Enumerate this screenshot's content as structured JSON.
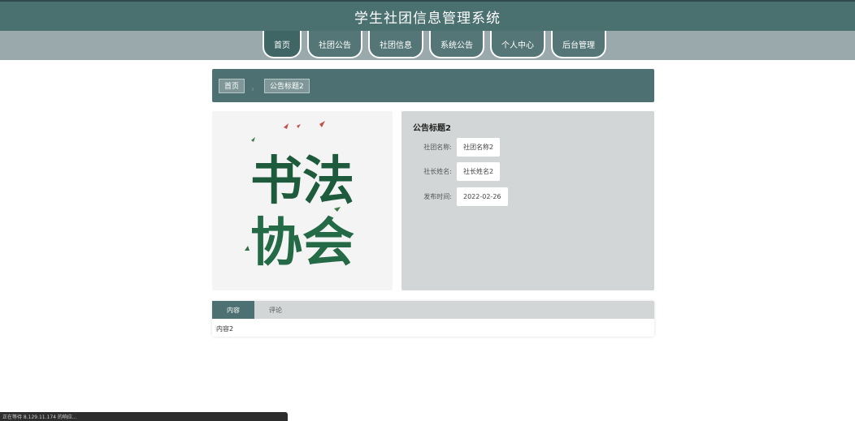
{
  "header": {
    "title": "学生社团信息管理系统"
  },
  "nav": {
    "items": [
      {
        "label": "首页"
      },
      {
        "label": "社团公告"
      },
      {
        "label": "社团信息"
      },
      {
        "label": "系统公告"
      },
      {
        "label": "个人中心"
      },
      {
        "label": "后台管理"
      }
    ]
  },
  "breadcrumb": {
    "home": "首页",
    "current": "公告标题2"
  },
  "image": {
    "text_line1": "书法",
    "text_line2": "协会"
  },
  "detail": {
    "title": "公告标题2",
    "fields": [
      {
        "label": "社团名称:",
        "value": "社团名称2"
      },
      {
        "label": "社长姓名:",
        "value": "社长姓名2"
      },
      {
        "label": "发布时间:",
        "value": "2022-02-26"
      }
    ]
  },
  "tabs": [
    {
      "label": "内容"
    },
    {
      "label": "评论"
    }
  ],
  "content": {
    "text": "内容2"
  },
  "status": {
    "text": "正在等待 8.129.11.174 的响应..."
  },
  "colors": {
    "primary": "#4a7070",
    "nav_band": "#9aa9ab",
    "panel": "#d3d6d6",
    "ink_green": "#1e5a3c"
  }
}
